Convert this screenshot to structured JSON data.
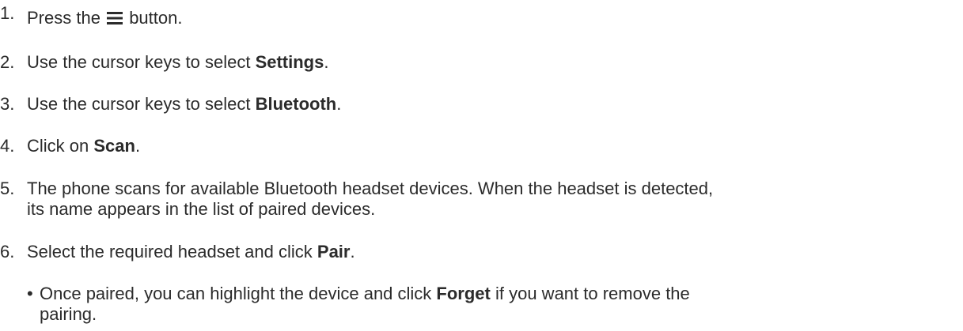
{
  "steps": [
    {
      "num": "1.",
      "pre": "Press the",
      "icon": "menu-icon",
      "post": "button."
    },
    {
      "num": "2.",
      "pre": "Use the cursor keys to select ",
      "bold": "Settings",
      "post": "."
    },
    {
      "num": "3.",
      "pre": "Use the cursor keys to select ",
      "bold": "Bluetooth",
      "post": "."
    },
    {
      "num": "4.",
      "pre": "Click on ",
      "bold": "Scan",
      "post": "."
    },
    {
      "num": "5.",
      "line1": "The phone scans for available Bluetooth headset devices. When the headset is detected,",
      "line2": "its name appears in the list of paired devices."
    },
    {
      "num": "6.",
      "pre": "Select the required headset and click ",
      "bold": "Pair",
      "post": "."
    }
  ],
  "note": {
    "bullet": "•",
    "pre": "Once paired, you can highlight the device and click ",
    "bold": "Forget",
    "post": " if you want to remove the",
    "line2": "pairing."
  }
}
